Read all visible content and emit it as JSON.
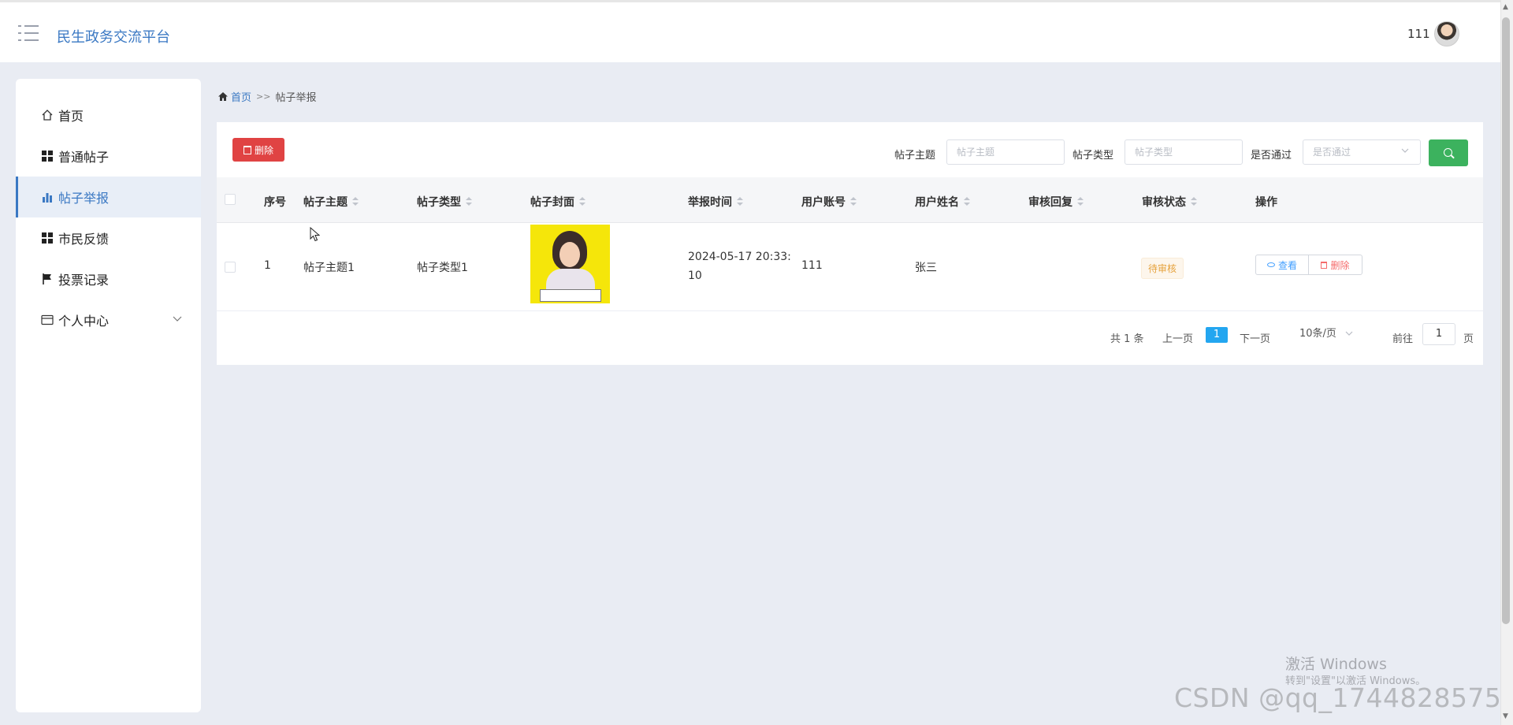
{
  "header": {
    "brand": "民生政务交流平台",
    "user_name": "111"
  },
  "sidebar": {
    "items": [
      {
        "label": "首页",
        "icon": "home-icon"
      },
      {
        "label": "普通帖子",
        "icon": "grid-icon"
      },
      {
        "label": "帖子举报",
        "icon": "bar-chart-icon",
        "active": true
      },
      {
        "label": "市民反馈",
        "icon": "grid-icon"
      },
      {
        "label": "投票记录",
        "icon": "flag-icon"
      },
      {
        "label": "个人中心",
        "icon": "card-icon"
      }
    ]
  },
  "breadcrumb": {
    "home": "首页",
    "separator": ">>",
    "current": "帖子举报"
  },
  "toolbar": {
    "delete_label": "删除",
    "filters": [
      {
        "label": "帖子主题",
        "placeholder": "帖子主题",
        "value": ""
      },
      {
        "label": "帖子类型",
        "placeholder": "帖子类型",
        "value": ""
      },
      {
        "label": "是否通过",
        "placeholder": "是否通过",
        "value": ""
      }
    ]
  },
  "table": {
    "columns": [
      "序号",
      "帖子主题",
      "帖子类型",
      "帖子封面",
      "举报时间",
      "用户账号",
      "用户姓名",
      "审核回复",
      "审核状态",
      "操作"
    ],
    "rows": [
      {
        "index": "1",
        "title": "帖子主题1",
        "type": "帖子类型1",
        "report_time_1": "2024-05-17 20:33:",
        "report_time_2": "10",
        "account": "111",
        "name": "张三",
        "reply": "",
        "status": "待审核",
        "view_label": "查看",
        "delete_label": "删除"
      }
    ]
  },
  "pagination": {
    "total": "共 1 条",
    "prev": "上一页",
    "current": "1",
    "next": "下一页",
    "page_size": "10条/页",
    "goto_prefix": "前往",
    "goto_value": "1",
    "goto_suffix": "页"
  },
  "watermarks": {
    "windows_title": "激活 Windows",
    "windows_sub": "转到\"设置\"以激活 Windows。",
    "csdn": "CSDN @qq_1744828575"
  },
  "colors": {
    "brand": "#3a78c3",
    "danger": "#e04343",
    "success": "#3cb25e",
    "pager_active": "#23a6f0",
    "status_pending": "#e6a23c"
  }
}
